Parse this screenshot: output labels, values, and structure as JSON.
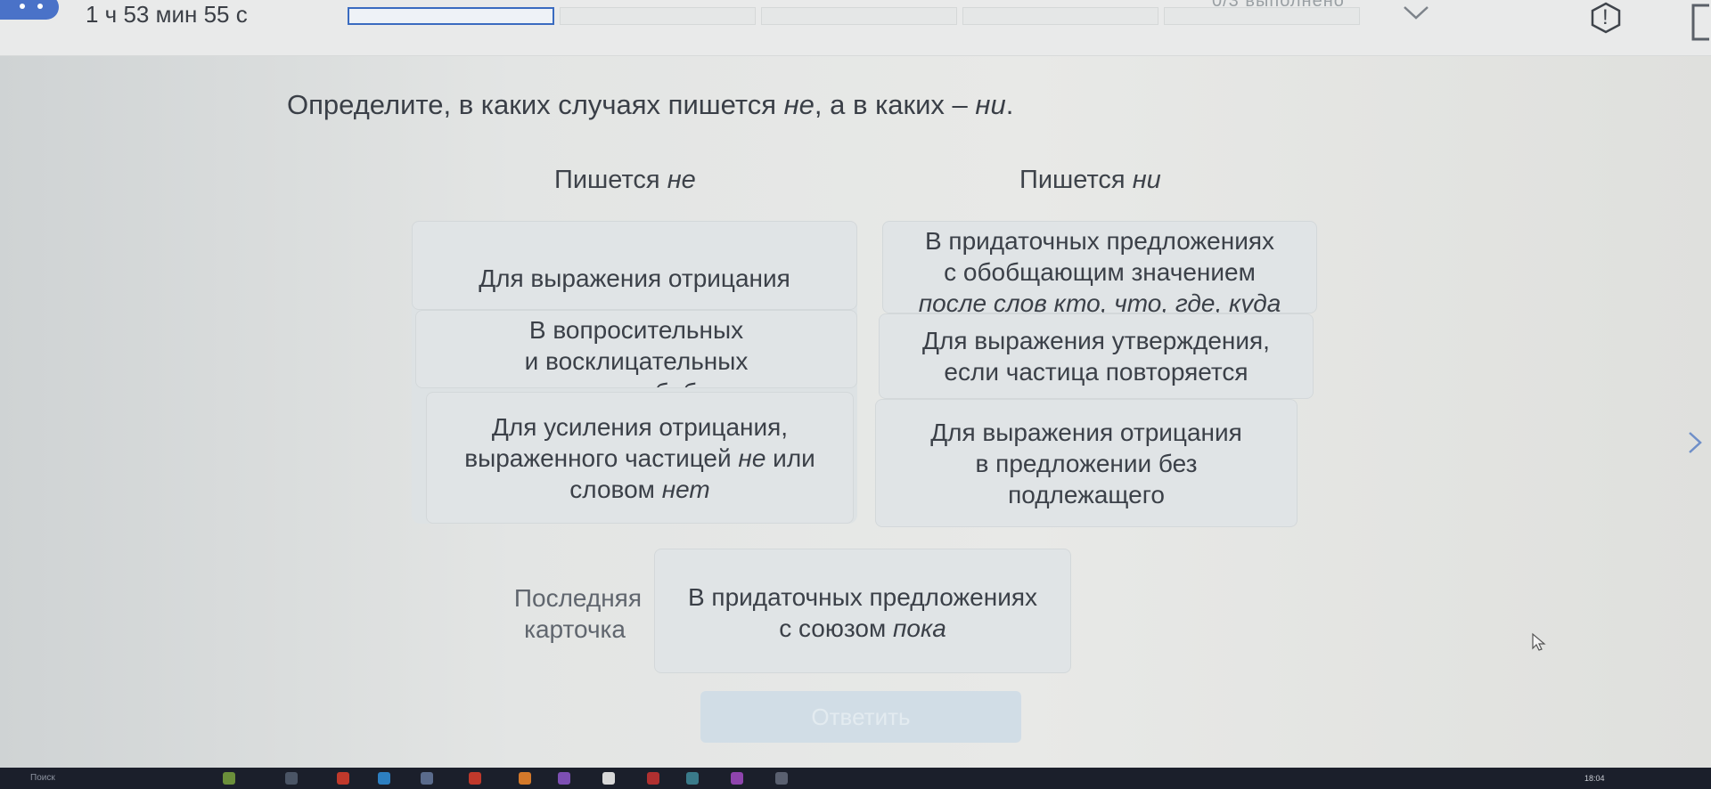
{
  "topbar": {
    "timer": "1 ч 53 мин 55 с",
    "progress_label": "0/3 выполнено",
    "alert_label": "!",
    "segments": 5
  },
  "question": {
    "prefix": "Определите, в каких случаях пишется ",
    "ne": "не",
    "middle": ", а в каких – ",
    "ni": "ни",
    "suffix": "."
  },
  "columns": {
    "left": {
      "prefix": "Пишется ",
      "particle": "не"
    },
    "right": {
      "prefix": "Пишется ",
      "particle": "ни"
    }
  },
  "cards": {
    "left_1": "Для выражения отрицания",
    "left_2_line1": "В вопросительных",
    "left_2_line2": "и восклицательных",
    "left_2_line3": "предложениях обобщающего",
    "left_3_line1": "Для усиления отрицания,",
    "left_3_line2_a": "выраженного частицей ",
    "left_3_line2_it": "не",
    "left_3_line2_b": " или",
    "left_3_line3_a": "словом ",
    "left_3_line3_it": "нет",
    "right_1_line1": "В придаточных предложениях",
    "right_1_line2": "с обобщающим значением",
    "right_1_line3": "после слов кто, что, где, куда",
    "right_2_line1": "Для выражения утверждения,",
    "right_2_line2": "если частица повторяется",
    "right_3_line1": "Для выражения отрицания",
    "right_3_line2": "в предложении без",
    "right_3_line3": "подлежащего"
  },
  "last_card": {
    "label_line1": "Последняя",
    "label_line2": "карточка",
    "text_line1": "В придаточных предложениях",
    "text_line2_a": "с союзом ",
    "text_line2_it": "пока"
  },
  "answer_button": "Ответить",
  "taskbar": {
    "search": "Поиск",
    "clock": "18:04"
  }
}
